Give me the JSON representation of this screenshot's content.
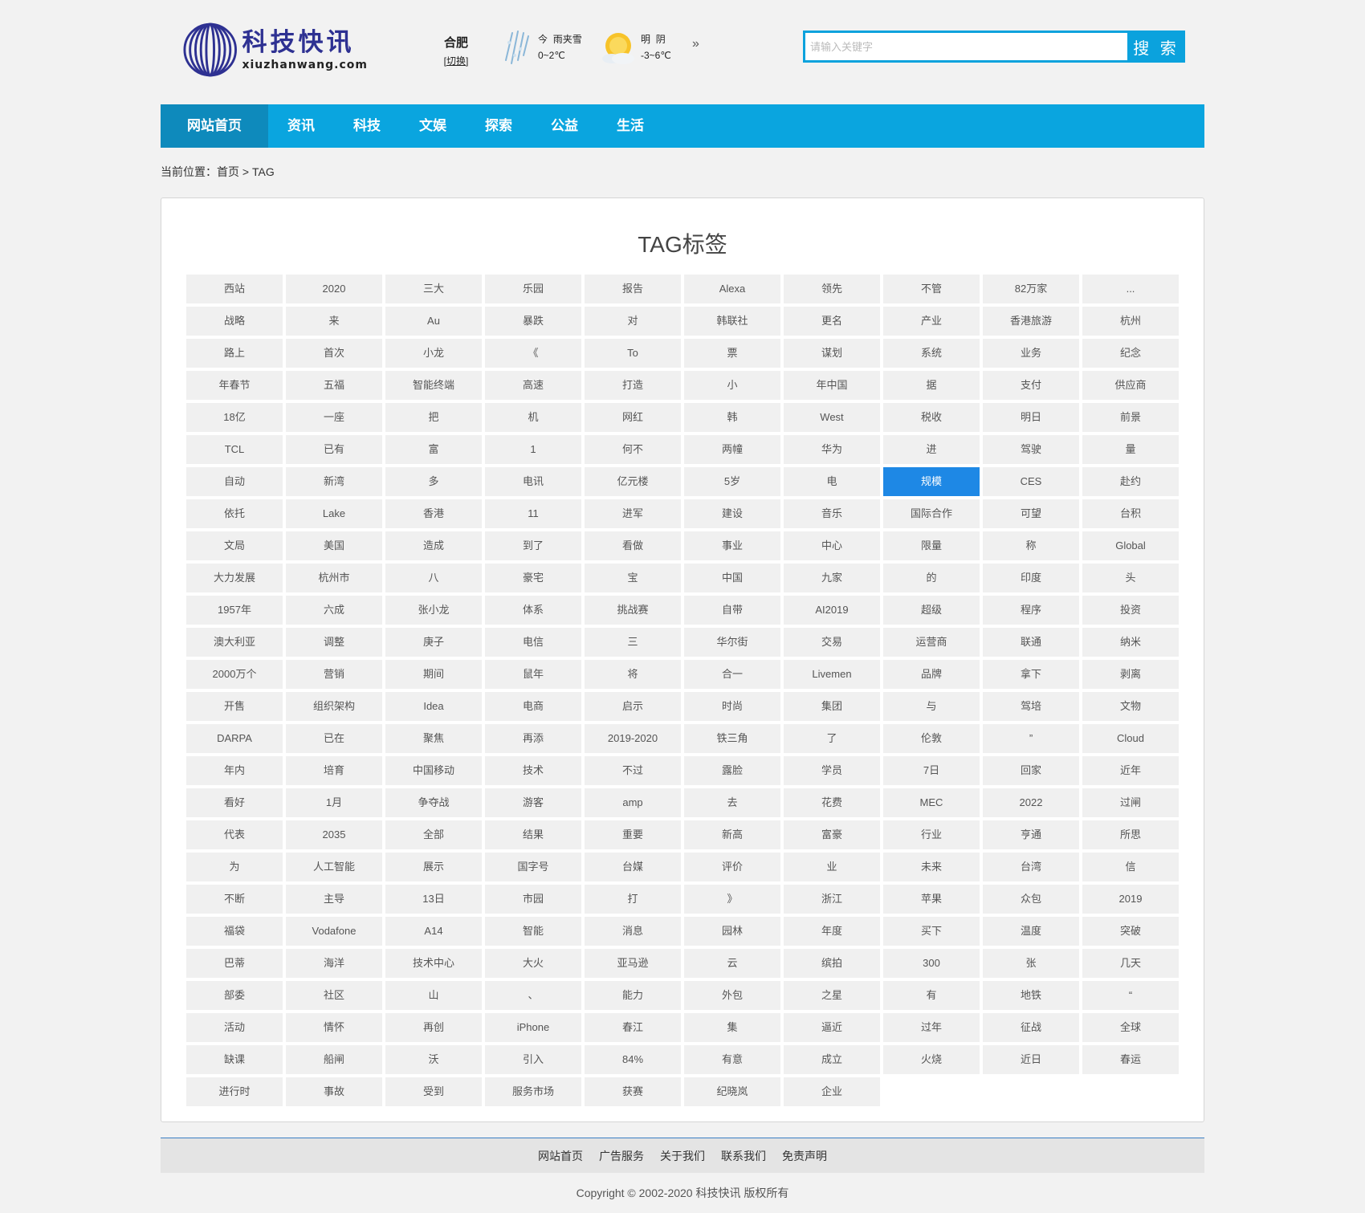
{
  "header": {
    "logo_cn": "科技快讯",
    "logo_en": "xiuzhanwang.com",
    "city": "合肥",
    "city_switch": "切换",
    "weather": [
      {
        "day": "今",
        "condition": "雨夹雪",
        "temp": "0~2℃",
        "icon": "sleet-icon"
      },
      {
        "day": "明",
        "condition": "阴",
        "temp": "-3~6℃",
        "icon": "cloudy-sun-icon"
      }
    ],
    "more": "»",
    "search_placeholder": "请输入关键字",
    "search_button": "搜 索"
  },
  "nav": {
    "items": [
      "网站首页",
      "资讯",
      "科技",
      "文娱",
      "探索",
      "公益",
      "生活"
    ],
    "active_index": 0
  },
  "breadcrumb": {
    "prefix": "当前位置：",
    "home": "首页",
    "separator": ">",
    "current": "TAG"
  },
  "main": {
    "title": "TAG标签",
    "active_tag": "规模",
    "tags": [
      "西站",
      "2020",
      "三大",
      "乐园",
      "报告",
      "Alexa",
      "领先",
      "不管",
      "82万家",
      "...",
      "战略",
      "来",
      "Au",
      "暴跌",
      "对",
      "韩联社",
      "更名",
      "产业",
      "香港旅游",
      "杭州",
      "路上",
      "首次",
      "小龙",
      "《",
      "To",
      "票",
      "谋划",
      "系统",
      "业务",
      "纪念",
      "年春节",
      "五福",
      "智能终端",
      "高速",
      "打造",
      "小",
      "年中国",
      "据",
      "支付",
      "供应商",
      "18亿",
      "一座",
      "把",
      "机",
      "网红",
      "韩",
      "West",
      "税收",
      "明日",
      "前景",
      "TCL",
      "已有",
      "富",
      "1",
      "何不",
      "两幢",
      "华为",
      "进",
      "驾驶",
      "量",
      "自动",
      "新湾",
      "多",
      "电讯",
      "亿元楼",
      "5岁",
      "电",
      "规模",
      "CES",
      "赴约",
      "依托",
      "Lake",
      "香港",
      "11",
      "进军",
      "建设",
      "音乐",
      "国际合作",
      "可望",
      "台积",
      "文局",
      "美国",
      "造成",
      "到了",
      "看做",
      "事业",
      "中心",
      "限量",
      "称",
      "Global",
      "大力发展",
      "杭州市",
      "八",
      "豪宅",
      "宝",
      "中国",
      "九家",
      "的",
      "印度",
      "头",
      "1957年",
      "六成",
      "张小龙",
      "体系",
      "挑战赛",
      "自带",
      "AI2019",
      "超级",
      "程序",
      "投资",
      "澳大利亚",
      "调整",
      "庚子",
      "电信",
      "三",
      "华尔街",
      "交易",
      "运营商",
      "联通",
      "纳米",
      "2000万个",
      "营销",
      "期间",
      "鼠年",
      "将",
      "合一",
      "Livemen",
      "品牌",
      "拿下",
      "剥离",
      "开售",
      "组织架构",
      "Idea",
      "电商",
      "启示",
      "时尚",
      "集团",
      "与",
      "驾培",
      "文物",
      "DARPA",
      "已在",
      "聚焦",
      "再添",
      "2019-2020",
      "铁三角",
      "了",
      "伦敦",
      "”",
      "Cloud",
      "年内",
      "培育",
      "中国移动",
      "技术",
      "不过",
      "露脸",
      "学员",
      "7日",
      "回家",
      "近年",
      "看好",
      "1月",
      "争夺战",
      "游客",
      "amp",
      "去",
      "花费",
      "MEC",
      "2022",
      "过闸",
      "代表",
      "2035",
      "全部",
      "结果",
      "重要",
      "新高",
      "富豪",
      "行业",
      "亨通",
      "所思",
      "为",
      "人工智能",
      "展示",
      "国字号",
      "台媒",
      "评价",
      "业",
      "未来",
      "台湾",
      "信",
      "不断",
      "主导",
      "13日",
      "市园",
      "打",
      "》",
      "浙江",
      "苹果",
      "众包",
      "2019",
      "福袋",
      "Vodafone",
      "A14",
      "智能",
      "消息",
      "园林",
      "年度",
      "买下",
      "温度",
      "突破",
      "巴蒂",
      "海洋",
      "技术中心",
      "大火",
      "亚马逊",
      "云",
      "缤拍",
      "300",
      "张",
      "几天",
      "部委",
      "社区",
      "山",
      "、",
      "能力",
      "外包",
      "之星",
      "有",
      "地铁",
      "“",
      "活动",
      "情怀",
      "再创",
      "iPhone",
      "春江",
      "集",
      "逼近",
      "过年",
      "征战",
      "全球",
      "缺课",
      "船闸",
      "沃",
      "引入",
      "84%",
      "有意",
      "成立",
      "火烧",
      "近日",
      "春运",
      "进行时",
      "事故",
      "受到",
      "服务市场",
      "获赛",
      "纪晓岚",
      "企业"
    ]
  },
  "footer": {
    "links": [
      "网站首页",
      "广告服务",
      "关于我们",
      "联系我们",
      "免责声明"
    ],
    "copyright": "Copyright © 2002-2020 科技快讯 版权所有"
  },
  "colors": {
    "nav_bg": "#0aa5df",
    "nav_active": "#0e8abc",
    "tag_active": "#1e88e5",
    "logo": "#2e3192"
  }
}
